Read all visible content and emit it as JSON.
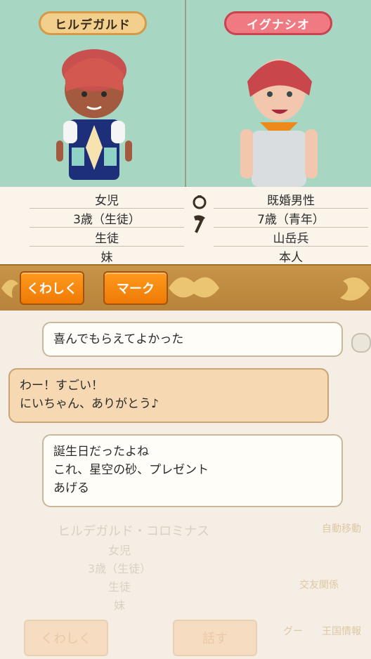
{
  "left_character": {
    "name": "ヒルデガルド",
    "info": [
      "女児",
      "3歳（生徒）",
      "生徒",
      "妹"
    ]
  },
  "right_character": {
    "name": "イグナシオ",
    "info": [
      "既婚男性",
      "7歳（青年）",
      "山岳兵",
      "本人"
    ]
  },
  "buttons": {
    "detail": "くわしく",
    "mark": "マーク"
  },
  "messages": [
    {
      "speaker": "right",
      "text": "喜んでもらえてよかった"
    },
    {
      "speaker": "left",
      "lines": [
        "わー！すごい！",
        "にいちゃん、ありがとう♪"
      ]
    },
    {
      "speaker": "right",
      "lines": [
        "誕生日だったよね",
        "これ、星空の砂、プレゼント",
        "あげる"
      ]
    }
  ],
  "background_panel": {
    "full_name": "ヒルデガルド・コロミナス",
    "info": [
      "女児",
      "3歳（生徒）",
      "生徒",
      "妹"
    ],
    "detail_button": "くわしく",
    "talk_button": "話す",
    "menu": {
      "auto_move": "自動移動",
      "relations": "交友関係",
      "kingdom_info": "王国情報",
      "side_label": "グー"
    }
  },
  "colors": {
    "portrait_bg": "#a7d6c3",
    "left_plate": "#f2cf8c",
    "right_plate": "#f07a82",
    "action_button": "#ee7a05",
    "action_bar": "#c08c42"
  },
  "icons": [
    "ring-icon",
    "axe-icon",
    "ornament-icon"
  ]
}
